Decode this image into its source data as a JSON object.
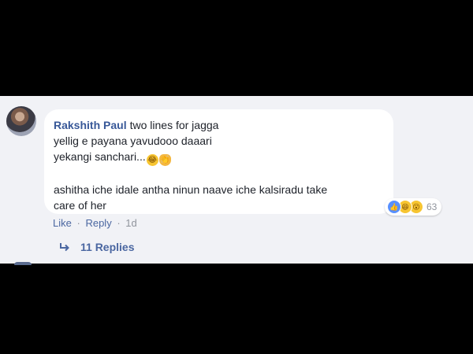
{
  "comment": {
    "author": "Rakshith Paul",
    "first_line": "two lines for jagga",
    "line2": "yellig e payana yavudooo daaari",
    "line3": "yekangi sanchari...",
    "line4": "ashitha iche idale antha ninun naave iche kalsiradu take",
    "line5": "care of her",
    "emojis": [
      "tears-of-joy-emoji",
      "clapping-hands-emoji"
    ]
  },
  "reactions": {
    "icons": [
      "like-icon",
      "haha-icon",
      "wow-icon"
    ],
    "count": "63"
  },
  "actions": {
    "like": "Like",
    "reply": "Reply",
    "separator": "·",
    "time": "1d"
  },
  "replies": {
    "label": "11 Replies"
  },
  "colors": {
    "background": "#000000",
    "panel": "#f1f2f6",
    "bubble": "#ffffff",
    "author_link": "#385898",
    "action_link": "#4b67a1",
    "muted_text": "#90949c",
    "like_blue": "#5890ff"
  }
}
